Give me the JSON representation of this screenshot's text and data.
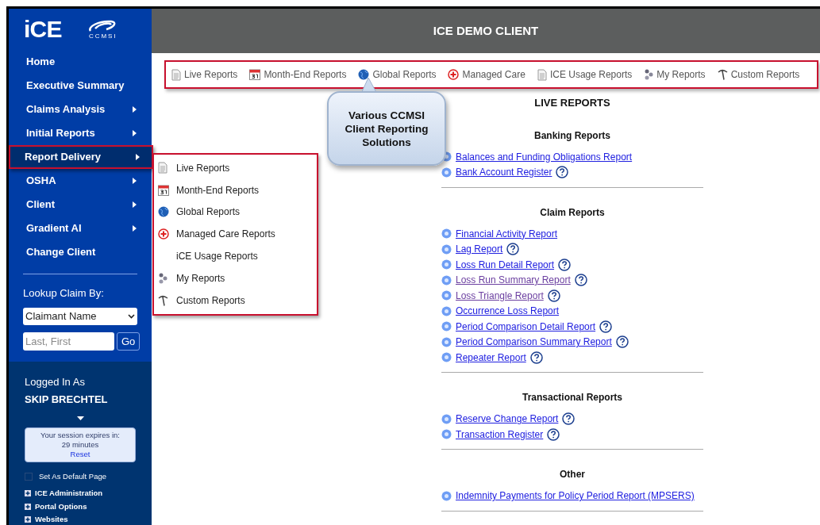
{
  "logo": {
    "text": "iCE",
    "partner": "CCMSI"
  },
  "header": {
    "title": "ICE DEMO CLIENT"
  },
  "sidebar": {
    "items": [
      {
        "label": "Home",
        "has_submenu": false,
        "selected": false
      },
      {
        "label": "Executive Summary",
        "has_submenu": false,
        "selected": false
      },
      {
        "label": "Claims Analysis",
        "has_submenu": true,
        "selected": false
      },
      {
        "label": "Initial Reports",
        "has_submenu": true,
        "selected": false
      },
      {
        "label": "Report Delivery",
        "has_submenu": true,
        "selected": true
      },
      {
        "label": "OSHA",
        "has_submenu": true,
        "selected": false
      },
      {
        "label": "Client",
        "has_submenu": true,
        "selected": false
      },
      {
        "label": "Gradient AI",
        "has_submenu": true,
        "selected": false
      },
      {
        "label": "Change Client",
        "has_submenu": false,
        "selected": false
      }
    ],
    "lookup": {
      "label": "Lookup Claim By:",
      "select_value": "Claimant Name",
      "placeholder": "Last, First",
      "button": "Go"
    },
    "user": {
      "label": "Logged In As",
      "name": "SKIP BRECHTEL"
    },
    "session": {
      "line1": "Your session expires in:",
      "line2": "29 minutes",
      "link": "Reset"
    },
    "default_page": {
      "label": "Set As Default Page",
      "checked": false
    },
    "tree": [
      {
        "label": "ICE Administration",
        "expanded": false
      },
      {
        "label": "Portal Options",
        "expanded": false
      },
      {
        "label": "Websites",
        "expanded": false
      }
    ]
  },
  "toolbar": [
    {
      "label": "Live Reports",
      "kind": "document"
    },
    {
      "label": "Month-End Reports",
      "kind": "calendar"
    },
    {
      "label": "Global Reports",
      "kind": "globe"
    },
    {
      "label": "Managed Care",
      "kind": "medical"
    },
    {
      "label": "ICE Usage Reports",
      "kind": "document"
    },
    {
      "label": "My Reports",
      "kind": "dots"
    },
    {
      "label": "Custom Reports",
      "kind": "pick"
    }
  ],
  "flyout": [
    {
      "label": "Live Reports",
      "kind": "document"
    },
    {
      "label": "Month-End Reports",
      "kind": "calendar"
    },
    {
      "label": "Global Reports",
      "kind": "globe"
    },
    {
      "label": "Managed Care Reports",
      "kind": "medical"
    },
    {
      "label": "iCE Usage Reports",
      "kind": "plain"
    },
    {
      "label": "My Reports",
      "kind": "dots"
    },
    {
      "label": "Custom Reports",
      "kind": "pick"
    }
  ],
  "callout": {
    "text": "Various CCMSI Client Reporting Solutions"
  },
  "content": {
    "title": "LIVE REPORTS",
    "sections": [
      {
        "heading": "Banking Reports",
        "links": [
          {
            "label": "Balances and Funding Obligations Report",
            "help": false,
            "visited": false
          },
          {
            "label": "Bank Account Register",
            "help": true,
            "visited": false
          }
        ]
      },
      {
        "heading": "Claim Reports",
        "links": [
          {
            "label": "Financial Activity Report",
            "help": false,
            "visited": false
          },
          {
            "label": "Lag Report",
            "help": true,
            "visited": false
          },
          {
            "label": "Loss Run Detail Report",
            "help": true,
            "visited": false
          },
          {
            "label": "Loss Run Summary Report",
            "help": true,
            "visited": true
          },
          {
            "label": "Loss Triangle Report",
            "help": true,
            "visited": true
          },
          {
            "label": "Occurrence Loss Report",
            "help": false,
            "visited": false
          },
          {
            "label": "Period Comparison Detail Report",
            "help": true,
            "visited": false
          },
          {
            "label": "Period Comparison Summary Report",
            "help": true,
            "visited": false
          },
          {
            "label": "Repeater Report",
            "help": true,
            "visited": false
          }
        ]
      },
      {
        "heading": "Transactional Reports",
        "links": [
          {
            "label": "Reserve Change Report",
            "help": true,
            "visited": false
          },
          {
            "label": "Transaction Register",
            "help": true,
            "visited": false
          }
        ]
      },
      {
        "heading": "Other",
        "links": [
          {
            "label": "Indemnity Payments for Policy Period Report (MPSERS)",
            "help": false,
            "visited": false
          }
        ]
      }
    ]
  }
}
